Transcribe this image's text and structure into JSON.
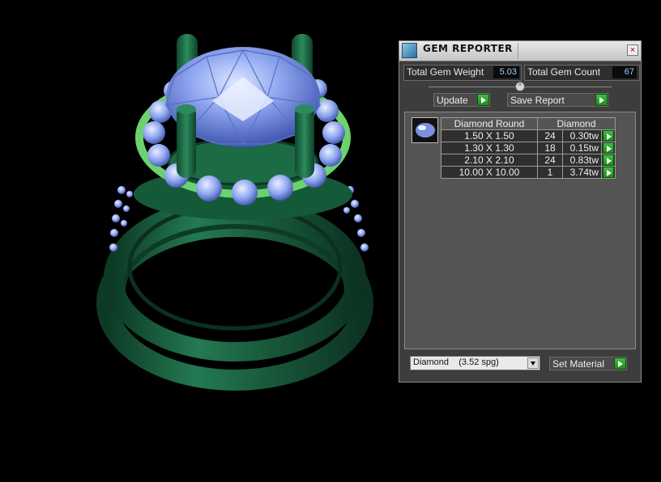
{
  "panel": {
    "title": "GEM REPORTER",
    "close_label": "×",
    "total_weight_label": "Total Gem Weight",
    "total_weight_value": "5.03",
    "total_count_label": "Total Gem Count",
    "total_count_value": "67",
    "collapse_label": "^",
    "update_label": "Update",
    "save_report_label": "Save Report",
    "table": {
      "headers": [
        "Diamond Round",
        "Diamond"
      ],
      "rows": [
        {
          "size": "1.50 X 1.50",
          "count": "24",
          "weight": "0.30tw"
        },
        {
          "size": "1.30 X 1.30",
          "count": "18",
          "weight": "0.15tw"
        },
        {
          "size": "2.10 X 2.10",
          "count": "24",
          "weight": "0.83tw"
        },
        {
          "size": "10.00 X 10.00",
          "count": "1",
          "weight": "3.74tw"
        }
      ]
    },
    "material_select": "Diamond    (3.52 spg)",
    "set_material_label": "Set Material"
  },
  "colors": {
    "metal": "#1f6b47",
    "metal_dark": "#0f3d27",
    "gem": "#8fa6f0",
    "prong_tip": "#6cd36c",
    "accent_green": "#2aa52a"
  },
  "icons": {
    "title": "gem-reporter-icon",
    "close": "close-icon",
    "play": "play-arrow-icon",
    "dropdown": "chevron-down-icon"
  }
}
